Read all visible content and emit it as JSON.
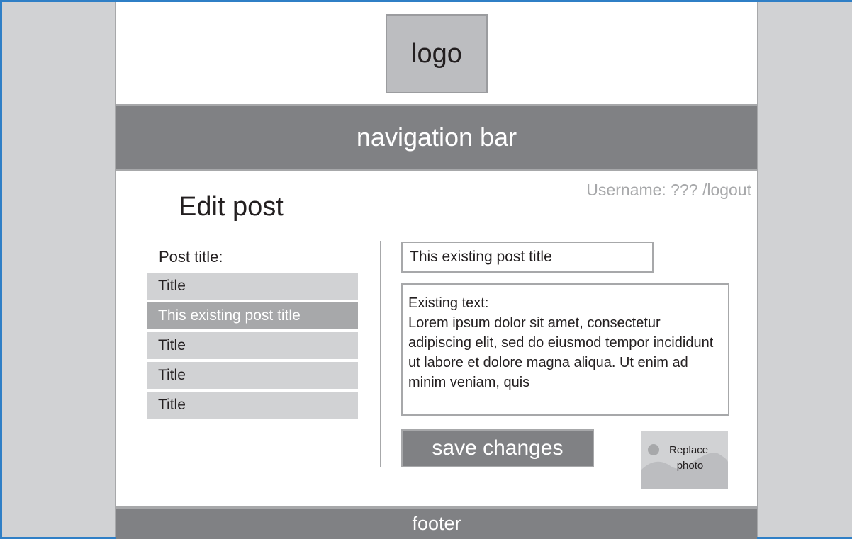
{
  "header": {
    "logo_text": "logo"
  },
  "nav": {
    "label": "navigation bar"
  },
  "user": {
    "text": "Username: ??? ",
    "logout": "/logout"
  },
  "main": {
    "title": "Edit post",
    "post_title_label": "Post title:",
    "posts": [
      {
        "label": "Title",
        "selected": false
      },
      {
        "label": "This existing post title",
        "selected": true
      },
      {
        "label": "Title",
        "selected": false
      },
      {
        "label": "Title",
        "selected": false
      },
      {
        "label": "Title",
        "selected": false
      }
    ],
    "title_input_value": "This existing post title",
    "text_label": "Existing text:",
    "text_body": "Lorem ipsum dolor sit amet, consectetur adipiscing elit, sed do eiusmod tempor incididunt ut labore et dolore magna aliqua. Ut enim ad minim veniam, quis",
    "save_label": "save changes",
    "replace_photo_line1": "Replace",
    "replace_photo_line2": "photo",
    "replace_photo_icon": "image-icon"
  },
  "footer": {
    "label": "footer"
  },
  "colors": {
    "outer_border": "#2f7fc6",
    "gutter": "#d1d2d4",
    "dark_bar": "#808184",
    "light_item": "#d1d2d4",
    "selected_item": "#a7a8aa"
  }
}
